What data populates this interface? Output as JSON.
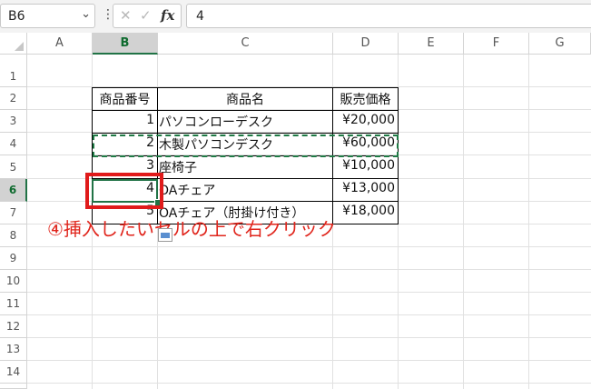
{
  "formula_bar": {
    "name_box": "B6",
    "name_box_dropdown": "⌄",
    "more_icon": "⋮",
    "cancel_icon": "✕",
    "enter_icon": "✓",
    "fx_label": "fx",
    "formula_value": "4"
  },
  "columns": [
    "A",
    "B",
    "C",
    "D",
    "E",
    "F",
    "G"
  ],
  "rows": [
    "1",
    "2",
    "3",
    "4",
    "5",
    "6",
    "7",
    "8",
    "9",
    "10",
    "11",
    "12",
    "13",
    "14",
    "15"
  ],
  "selected": {
    "column": "B",
    "row": "6"
  },
  "table": {
    "headers": [
      "商品番号",
      "商品名",
      "販売価格"
    ],
    "rows": [
      {
        "no": "1",
        "name": "パソコンローデスク",
        "price": "¥20,000"
      },
      {
        "no": "2",
        "name": "木製パソコンデスク",
        "price": "¥60,000"
      },
      {
        "no": "3",
        "name": "座椅子",
        "price": "¥10,000"
      },
      {
        "no": "4",
        "name": "OAチェア",
        "price": "¥13,000"
      },
      {
        "no": "5",
        "name": "OAチェア（肘掛け付き）",
        "price": "¥18,000"
      }
    ]
  },
  "annotation": "④挿入したいセルの上で右クリック",
  "colors": {
    "selection_green": "#217346",
    "annotation_red": "#e0241b"
  },
  "icons": [
    "chevron-down-icon",
    "more-vertical-icon",
    "cancel-icon",
    "enter-check-icon",
    "function-icon",
    "paste-options-icon"
  ]
}
